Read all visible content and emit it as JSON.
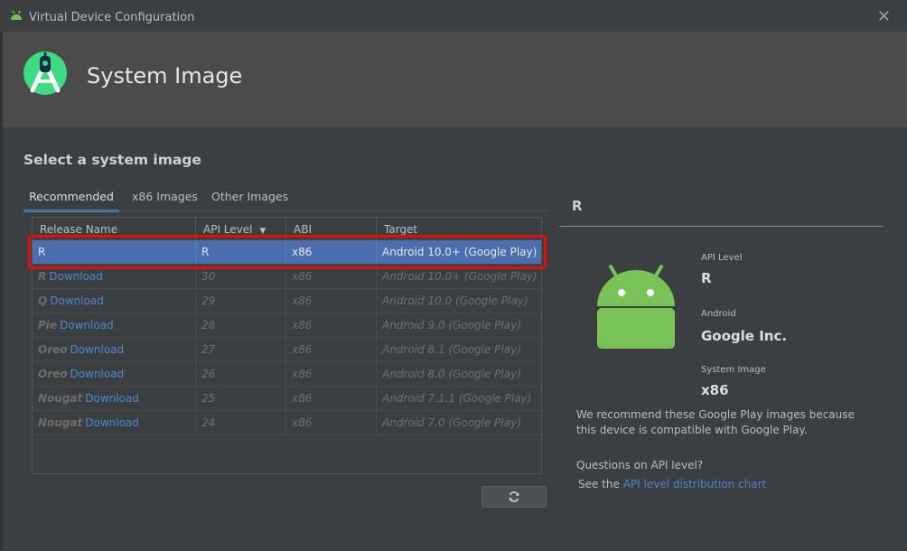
{
  "window": {
    "title": "Virtual Device Configuration",
    "close_glyph": "✕"
  },
  "header": {
    "title": "System Image"
  },
  "section_title": "Select a system image",
  "tabs": [
    {
      "label": "Recommended",
      "active": true
    },
    {
      "label": "x86 Images",
      "active": false
    },
    {
      "label": "Other Images",
      "active": false
    }
  ],
  "table": {
    "columns": [
      {
        "label": "Release Name"
      },
      {
        "label": "API Level",
        "sort": "▼"
      },
      {
        "label": "ABI"
      },
      {
        "label": "Target"
      }
    ],
    "rows": [
      {
        "release": "R",
        "download": "",
        "api": "R",
        "abi": "x86",
        "target": "Android 10.0+ (Google Play)",
        "selected": true
      },
      {
        "release": "R",
        "download": "Download",
        "api": "30",
        "abi": "x86",
        "target": "Android 10.0+ (Google Play)",
        "selected": false
      },
      {
        "release": "Q",
        "download": "Download",
        "api": "29",
        "abi": "x86",
        "target": "Android 10.0 (Google Play)",
        "selected": false
      },
      {
        "release": "Pie",
        "download": "Download",
        "api": "28",
        "abi": "x86",
        "target": "Android 9.0 (Google Play)",
        "selected": false
      },
      {
        "release": "Oreo",
        "download": "Download",
        "api": "27",
        "abi": "x86",
        "target": "Android 8.1 (Google Play)",
        "selected": false
      },
      {
        "release": "Oreo",
        "download": "Download",
        "api": "26",
        "abi": "x86",
        "target": "Android 8.0 (Google Play)",
        "selected": false
      },
      {
        "release": "Nougat",
        "download": "Download",
        "api": "25",
        "abi": "x86",
        "target": "Android 7.1.1 (Google Play)",
        "selected": false
      },
      {
        "release": "Nougat",
        "download": "Download",
        "api": "24",
        "abi": "x86",
        "target": "Android 7.0 (Google Play)",
        "selected": false
      }
    ]
  },
  "refresh_icon": "refresh-icon",
  "details": {
    "title": "R",
    "api_level_label": "API Level",
    "api_level_value": "R",
    "android_label": "Android",
    "android_value": "Google Inc.",
    "system_image_label": "System Image",
    "system_image_value": "x86",
    "recommendation": "We recommend these Google Play images because this device is compatible with Google Play.",
    "question": "Questions on API level?",
    "see_prefix": "See the ",
    "link_text": "API level distribution chart"
  },
  "colors": {
    "accent": "#4a88c7",
    "selection": "#4b6eaf",
    "highlight_box": "#e20d0d",
    "android_green": "#78c257"
  }
}
